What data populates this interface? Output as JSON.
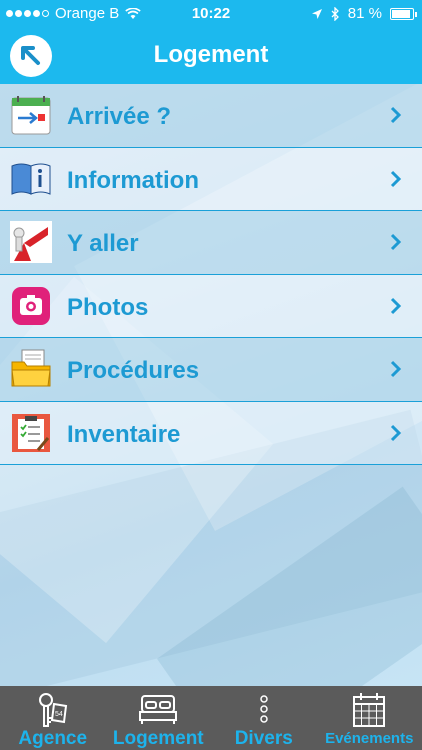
{
  "status_bar": {
    "carrier": "Orange B",
    "time": "10:22",
    "battery_percent_text": "81 %",
    "battery_level": 0.81
  },
  "nav_bar": {
    "title": "Logement",
    "back_icon": "arrow-up-left-icon"
  },
  "menu": {
    "items": [
      {
        "label": "Arrivée ?",
        "icon": "calendar-arrow-icon"
      },
      {
        "label": "Information",
        "icon": "book-info-icon"
      },
      {
        "label": "Y aller",
        "icon": "road-sign-icon"
      },
      {
        "label": "Photos",
        "icon": "camera-icon"
      },
      {
        "label": "Procédures",
        "icon": "folder-icon"
      },
      {
        "label": "Inventaire",
        "icon": "checklist-icon"
      }
    ]
  },
  "tab_bar": {
    "tabs": [
      {
        "label": "Agence",
        "icon": "keys-icon"
      },
      {
        "label": "Logement",
        "icon": "bed-icon"
      },
      {
        "label": "Divers",
        "icon": "more-dots-icon"
      },
      {
        "label": "Evénements",
        "icon": "calendar-icon"
      }
    ]
  },
  "colors": {
    "accent": "#1cb9ee",
    "label": "#1d9ad3",
    "tab_bar": "#5b5b5b"
  }
}
